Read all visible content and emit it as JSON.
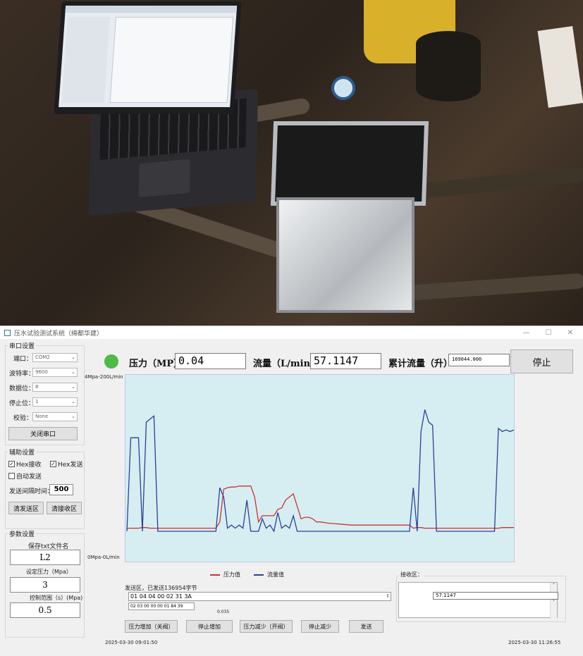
{
  "window": {
    "title": "压水试验测试系统（绵都华建）"
  },
  "serial": {
    "group_title": "串口设置",
    "port_label": "端口：",
    "port_value": "COM2",
    "baud_label": "波特率：",
    "baud_value": "9600",
    "data_bits_label": "数据位：",
    "data_bits_value": "8",
    "stop_bits_label": "停止位：",
    "stop_bits_value": "1",
    "parity_label": "校验：",
    "parity_value": "None",
    "close_port_button": "关闭串口"
  },
  "aux": {
    "group_title": "辅助设置",
    "hex_receive_label": "Hex接收",
    "hex_send_label": "Hex发送",
    "auto_send_label": "自动发送",
    "interval_label": "发送间隔时间：",
    "interval_value": "500",
    "clear_send_button": "清发送区",
    "clear_recv_button": "清接收区"
  },
  "params": {
    "group_title": "参数设置",
    "save_file_label": "保存txt文件名",
    "save_file_value": "L2",
    "set_pressure_label": "设定压力（Mpa）",
    "set_pressure_value": "3",
    "control_range_label": "控制范围（s）(Mpa)",
    "control_range_value": "0.5"
  },
  "readout": {
    "status_color": "#4cbb47",
    "pressure_label": "压力（MP）",
    "pressure_value": "0.04",
    "flow_label": "流量（L/min）",
    "flow_value": "57.1147",
    "total_label": "累计流量（升）",
    "total_value": "169044.000",
    "stop_button": "停止"
  },
  "chart_data": {
    "type": "line",
    "y_top_label": "4Mpa-200L/min",
    "y_bottom_label": "0Mpa-0L/min",
    "grid": false,
    "legend": "bottom",
    "x": [
      0,
      1,
      2,
      3,
      4,
      5,
      6,
      7,
      8,
      9,
      10,
      11,
      12,
      13,
      14,
      15,
      16,
      17,
      18,
      19,
      20,
      21,
      22,
      23,
      24,
      25,
      26,
      27,
      28,
      29,
      30,
      31,
      32,
      33,
      34,
      35,
      36,
      37,
      38,
      39,
      40,
      41,
      42,
      43,
      44,
      45,
      46,
      47,
      48,
      49,
      50,
      51,
      52,
      53,
      54,
      55,
      56,
      57,
      58,
      59,
      60,
      61,
      62,
      63,
      64,
      65,
      66,
      67,
      68,
      69,
      70,
      71,
      72,
      73,
      74,
      75,
      76,
      77,
      78,
      79,
      80,
      81,
      82,
      83,
      84,
      85,
      86,
      87,
      88,
      89,
      90,
      91,
      92,
      93,
      94,
      95,
      96,
      97,
      98,
      99,
      100
    ],
    "series": [
      {
        "name": "压力值",
        "color": "#d03030",
        "values": [
          0.1,
          0.1,
          0.1,
          0.1,
          0.12,
          0.12,
          0.1,
          0.1,
          0.1,
          0.1,
          0.1,
          0.1,
          0.1,
          0.1,
          0.1,
          0.1,
          0.1,
          0.1,
          0.1,
          0.1,
          0.1,
          0.1,
          0.1,
          0.1,
          0.3,
          1.35,
          1.4,
          1.42,
          1.42,
          1.45,
          1.45,
          1.45,
          1.45,
          1.1,
          0.3,
          0.5,
          0.5,
          0.5,
          0.5,
          0.7,
          0.75,
          1.0,
          1.1,
          1.2,
          0.8,
          0.4,
          0.45,
          0.45,
          0.4,
          0.3,
          0.3,
          0.28,
          0.26,
          0.25,
          0.24,
          0.23,
          0.22,
          0.21,
          0.2,
          0.2,
          0.2,
          0.2,
          0.2,
          0.2,
          0.2,
          0.2,
          0.2,
          0.2,
          0.2,
          0.2,
          0.2,
          0.2,
          0.2,
          0.2,
          0.1,
          0.12,
          0.12,
          0.1,
          0.1,
          0.1,
          0.1,
          0.1,
          0.1,
          0.1,
          0.1,
          0.1,
          0.1,
          0.1,
          0.1,
          0.1,
          0.1,
          0.1,
          0.1,
          0.1,
          0.1,
          0.1,
          0.1,
          0.12,
          0.12,
          0.12,
          0.12
        ]
      },
      {
        "name": "流量值",
        "color": "#2a3f9a",
        "values": [
          0,
          3,
          3,
          3,
          0,
          3.5,
          3.6,
          3.7,
          0,
          0,
          0,
          0,
          0,
          0,
          0,
          0,
          0,
          0,
          0,
          0,
          0,
          0,
          0,
          0,
          1.4,
          1.1,
          0.1,
          0.2,
          0.1,
          0.2,
          0.1,
          1.0,
          0,
          0,
          0,
          0.4,
          0.1,
          0.2,
          0,
          0.6,
          0.1,
          0.2,
          0.1,
          0.5,
          0,
          0,
          0,
          0,
          0,
          0,
          0,
          0,
          0,
          0,
          0,
          0,
          0,
          0,
          0,
          0,
          0,
          0,
          0,
          0,
          0,
          0,
          0,
          0,
          0,
          0,
          0,
          0,
          0,
          0,
          1.4,
          0,
          3.2,
          3.9,
          3.5,
          3.4,
          0,
          0,
          0,
          0,
          0,
          0,
          0,
          0,
          0,
          0,
          0,
          0,
          0,
          0,
          0,
          0,
          3.3,
          3.2,
          3.25,
          3.2,
          3.25
        ]
      }
    ]
  },
  "send": {
    "label": "发送区，已发送136954字节",
    "command_value": "01 04 04 00 02 31 3A",
    "last_value": "02 03 00 00 00 01 84 39",
    "small_value": "0.035",
    "btn_pressure_up": "压力增加（关阀）",
    "btn_stop_up": "停止增加",
    "btn_pressure_down": "压力减少（开阀）",
    "btn_stop_down": "停止减少",
    "btn_send": "发送"
  },
  "receive": {
    "label": "接收区：",
    "value": "57.1147"
  },
  "footer": {
    "start_time": "2025-03-30 09:01:50",
    "end_time": "2025-03-30 11:26:55"
  }
}
